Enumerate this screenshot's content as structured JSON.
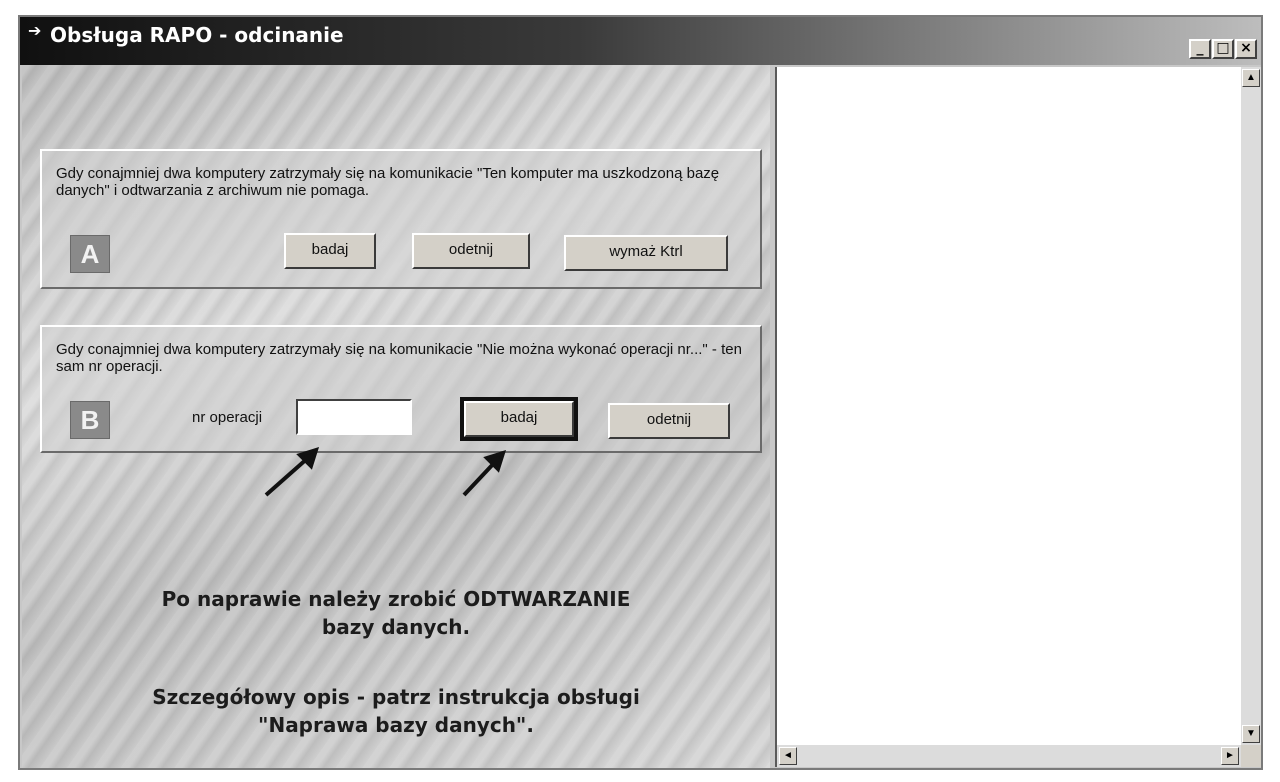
{
  "window": {
    "title": "Obsługa RAPO - odcinanie",
    "title_icon": "app-icon",
    "minimize_glyph": "_",
    "maximize_glyph": "□",
    "close_glyph": "×"
  },
  "section_a": {
    "letter": "A",
    "description": "Gdy conajmniej dwa komputery zatrzymały się na komunikacie \"Ten komputer ma uszkodzoną bazę danych\" i odtwarzania z archiwum nie pomaga.",
    "buttons": {
      "examine": "badaj",
      "cut_off": "odetnij",
      "delete_ktrl": "wymaż Ktrl"
    }
  },
  "section_b": {
    "letter": "B",
    "description": "Gdy conajmniej dwa komputery zatrzymały się na komunikacie \"Nie można wykonać operacji nr...\" - ten sam nr operacji.",
    "field_label": "nr operacji",
    "field_value": "",
    "buttons": {
      "examine": "badaj",
      "cut_off": "odetnij"
    }
  },
  "notes": {
    "line1": "Po naprawie należy zrobić ODTWARZANIE",
    "line2": "bazy danych.",
    "line3": "Szczegółowy opis - patrz instrukcja obsługi",
    "line4": "\"Naprawa bazy danych\"."
  },
  "scrollbar": {
    "up_glyph": "▲",
    "down_glyph": "▼",
    "left_glyph": "◄",
    "right_glyph": "►"
  }
}
